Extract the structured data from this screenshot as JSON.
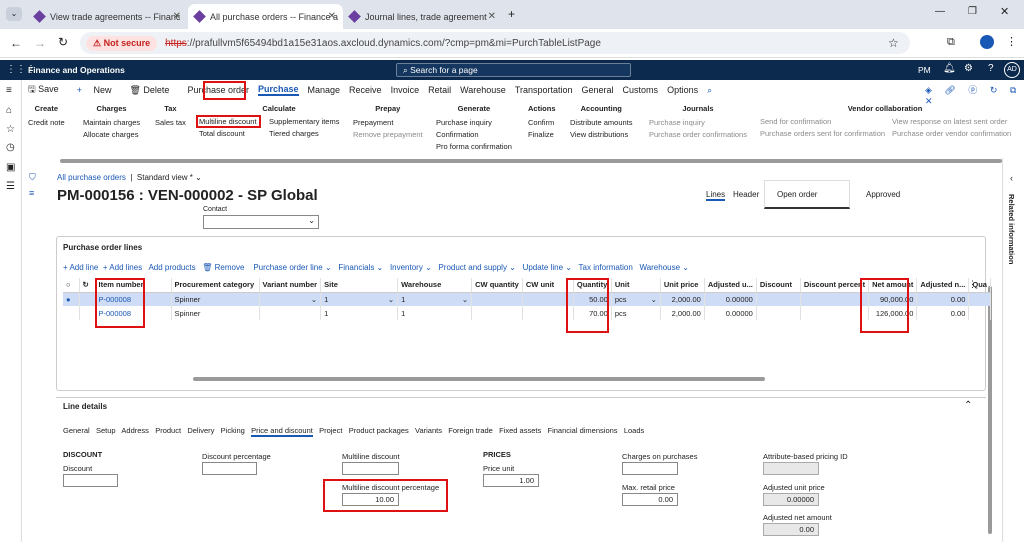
{
  "browser": {
    "tabs": [
      {
        "label": "View trade agreements -- Financ"
      },
      {
        "label": "All purchase orders -- Finance a"
      },
      {
        "label": "Journal lines, trade agreement"
      }
    ],
    "not_secure": "Not secure",
    "url_https": "https",
    "url_rest": "://prafullvm5f65494bd1a15e31aos.axcloud.dynamics.com/?cmp=pm&mi=PurchTableListPage"
  },
  "app": {
    "title": "Finance and Operations",
    "search_placeholder": "Search for a page",
    "company": "PM",
    "avatar": "AD"
  },
  "toolbar": {
    "save": "Save",
    "new": "New",
    "delete": "Delete",
    "items": [
      "Purchase order",
      "Purchase",
      "Manage",
      "Receive",
      "Invoice",
      "Retail",
      "Warehouse",
      "Transportation",
      "General",
      "Customs",
      "Options"
    ]
  },
  "ribbon": {
    "create": {
      "title": "Create",
      "items": [
        "Credit note"
      ]
    },
    "charges": {
      "title": "Charges",
      "items": [
        "Maintain charges",
        "Allocate charges"
      ]
    },
    "tax": {
      "title": "Tax",
      "items": [
        "Sales tax"
      ]
    },
    "calculate": {
      "title": "Calculate",
      "items": [
        "Multiline discount",
        "Total discount",
        "Supplementary items",
        "Tiered charges"
      ]
    },
    "prepay": {
      "title": "Prepay",
      "items": [
        "Prepayment",
        "Remove prepayment"
      ]
    },
    "generate": {
      "title": "Generate",
      "items": [
        "Purchase inquiry",
        "Confirmation",
        "Pro forma confirmation"
      ]
    },
    "actions": {
      "title": "Actions",
      "items": [
        "Confirm",
        "Finalize"
      ]
    },
    "accounting": {
      "title": "Accounting",
      "items": [
        "Distribute amounts",
        "View distributions"
      ]
    },
    "journals": {
      "title": "Journals",
      "items": [
        "Purchase inquiry",
        "Purchase order confirmations"
      ]
    },
    "vendor": {
      "title": "Vendor collaboration",
      "items": [
        "Send for confirmation",
        "Purchase orders sent for confirmation",
        "View response on latest sent order",
        "Purchase order vendor confirmation"
      ]
    }
  },
  "page": {
    "breadcrumb": "All purchase orders",
    "view": "Standard view *",
    "title": "PM-000156 : VEN-000002 - SP Global",
    "lines_tab": "Lines",
    "header_tab": "Header",
    "status1": "Open order",
    "status2": "Approved",
    "contact_label": "Contact"
  },
  "lines": {
    "section_title": "Purchase order lines",
    "actions": [
      "Add line",
      "Add lines",
      "Add products",
      "Remove",
      "Purchase order line",
      "Financials",
      "Inventory",
      "Product and supply",
      "Update line",
      "Tax information",
      "Warehouse"
    ],
    "columns": [
      "Item number",
      "Procurement category",
      "Variant number",
      "Site",
      "Warehouse",
      "CW quantity",
      "CW unit",
      "Quantity",
      "Unit",
      "Unit price",
      "Adjusted u...",
      "Discount",
      "Discount percent",
      "Net amount",
      "Adjusted n...",
      "Qua"
    ],
    "rows": [
      {
        "item": "P-000008",
        "category": "Spinner",
        "site": "1",
        "warehouse": "1",
        "qty": "50.00",
        "unit": "pcs",
        "price": "2,000.00",
        "adj": "0.00000",
        "net": "90,000.00",
        "adjn": "0.00"
      },
      {
        "item": "P-000008",
        "category": "Spinner",
        "site": "1",
        "warehouse": "1",
        "qty": "70.00",
        "unit": "pcs",
        "price": "2,000.00",
        "adj": "0.00000",
        "net": "126,000.00",
        "adjn": "0.00"
      }
    ]
  },
  "details": {
    "title": "Line details",
    "tabs": [
      "General",
      "Setup",
      "Address",
      "Product",
      "Delivery",
      "Picking",
      "Price and discount",
      "Project",
      "Product packages",
      "Variants",
      "Foreign trade",
      "Fixed assets",
      "Financial dimensions",
      "Loads"
    ],
    "discount_header": "DISCOUNT",
    "discount_label": "Discount",
    "discount_pct_label": "Discount percentage",
    "multiline_label": "Multiline discount",
    "multiline_pct_label": "Multiline discount percentage",
    "multiline_pct_value": "10.00",
    "prices_header": "PRICES",
    "price_unit_label": "Price unit",
    "price_unit_value": "1.00",
    "charges_label": "Charges on purchases",
    "max_retail_label": "Max. retail price",
    "max_retail_value": "0.00",
    "attr_label": "Attribute-based pricing ID",
    "adj_unit_label": "Adjusted unit price",
    "adj_unit_value": "0.00000",
    "adj_net_label": "Adjusted net amount",
    "adj_net_value": "0.00"
  },
  "right_pane": {
    "label": "Related information"
  }
}
